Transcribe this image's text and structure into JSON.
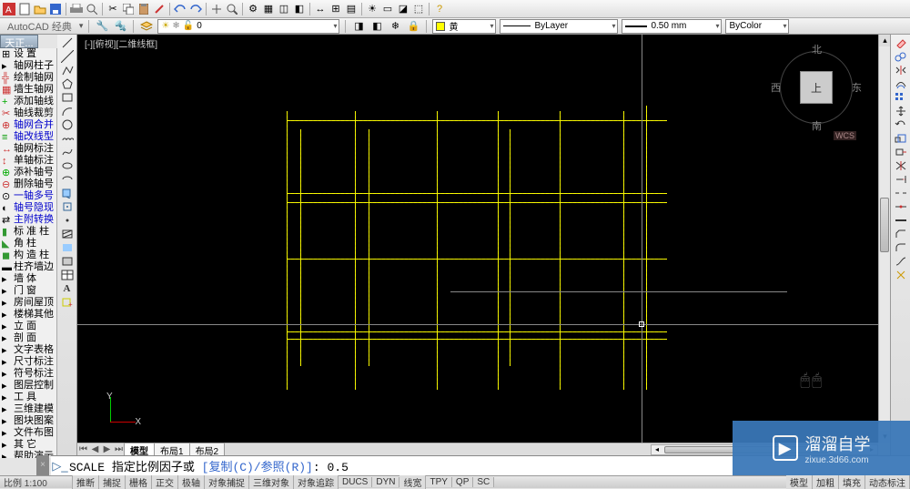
{
  "app": {
    "workspace": "AutoCAD 经典"
  },
  "quick": {
    "new": "",
    "open": "",
    "save": "",
    "undo": "",
    "redo": ""
  },
  "layer": {
    "layerLabel": "0",
    "colorName": "黄",
    "linetype": "ByLayer",
    "lineweight": "0.50 mm",
    "plotstyle": "ByColor"
  },
  "leftPanelTitle": "天正...",
  "leftItems": [
    "设   置",
    "轴网柱子",
    "绘制轴网",
    "墙生轴网",
    "添加轴线",
    "轴线裁剪",
    "轴网合并",
    "轴改线型",
    "轴网标注",
    "单轴标注",
    "添补轴号",
    "删除轴号",
    "一轴多号",
    "轴号隐现",
    "主附转换",
    "标 准 柱",
    "角    柱",
    "构 造 柱",
    "柱齐墙边",
    "墙    体",
    "门    窗",
    "房间屋顶",
    "楼梯其他",
    "立    面",
    "剖    面",
    "文字表格",
    "尺寸标注",
    "符号标注",
    "图层控制",
    "工    具",
    "三维建模",
    "图块图案",
    "文件布图",
    "其    它",
    "帮助演示"
  ],
  "viewport": {
    "label": "[-][俯视][二维线框]"
  },
  "viewcube": {
    "n": "北",
    "s": "南",
    "w": "西",
    "e": "东",
    "top": "上",
    "wcs": "WCS"
  },
  "ucs": {
    "x": "X",
    "y": "Y"
  },
  "tabs": {
    "model": "模型",
    "layout1": "布局1",
    "layout2": "布局2"
  },
  "command": {
    "cmd": "SCALE",
    "prompt": "指定比例因子或 ",
    "opts": "[复制(C)/参照(R)]",
    "colon": ": ",
    "value": "0.5"
  },
  "status": {
    "coord": "比例 1:100",
    "buttons": [
      "推断",
      "捕捉",
      "栅格",
      "正交",
      "极轴",
      "对象捕捉",
      "三维对象",
      "对象追踪",
      "DUCS",
      "DYN",
      "线宽",
      "TPY",
      "QP",
      "SC",
      "模型",
      "加粗",
      "填充",
      "动态标注"
    ]
  },
  "watermark": {
    "name": "溜溜自学",
    "url": "zixue.3d66.com"
  },
  "hscroll": {
    "thumb": ""
  }
}
